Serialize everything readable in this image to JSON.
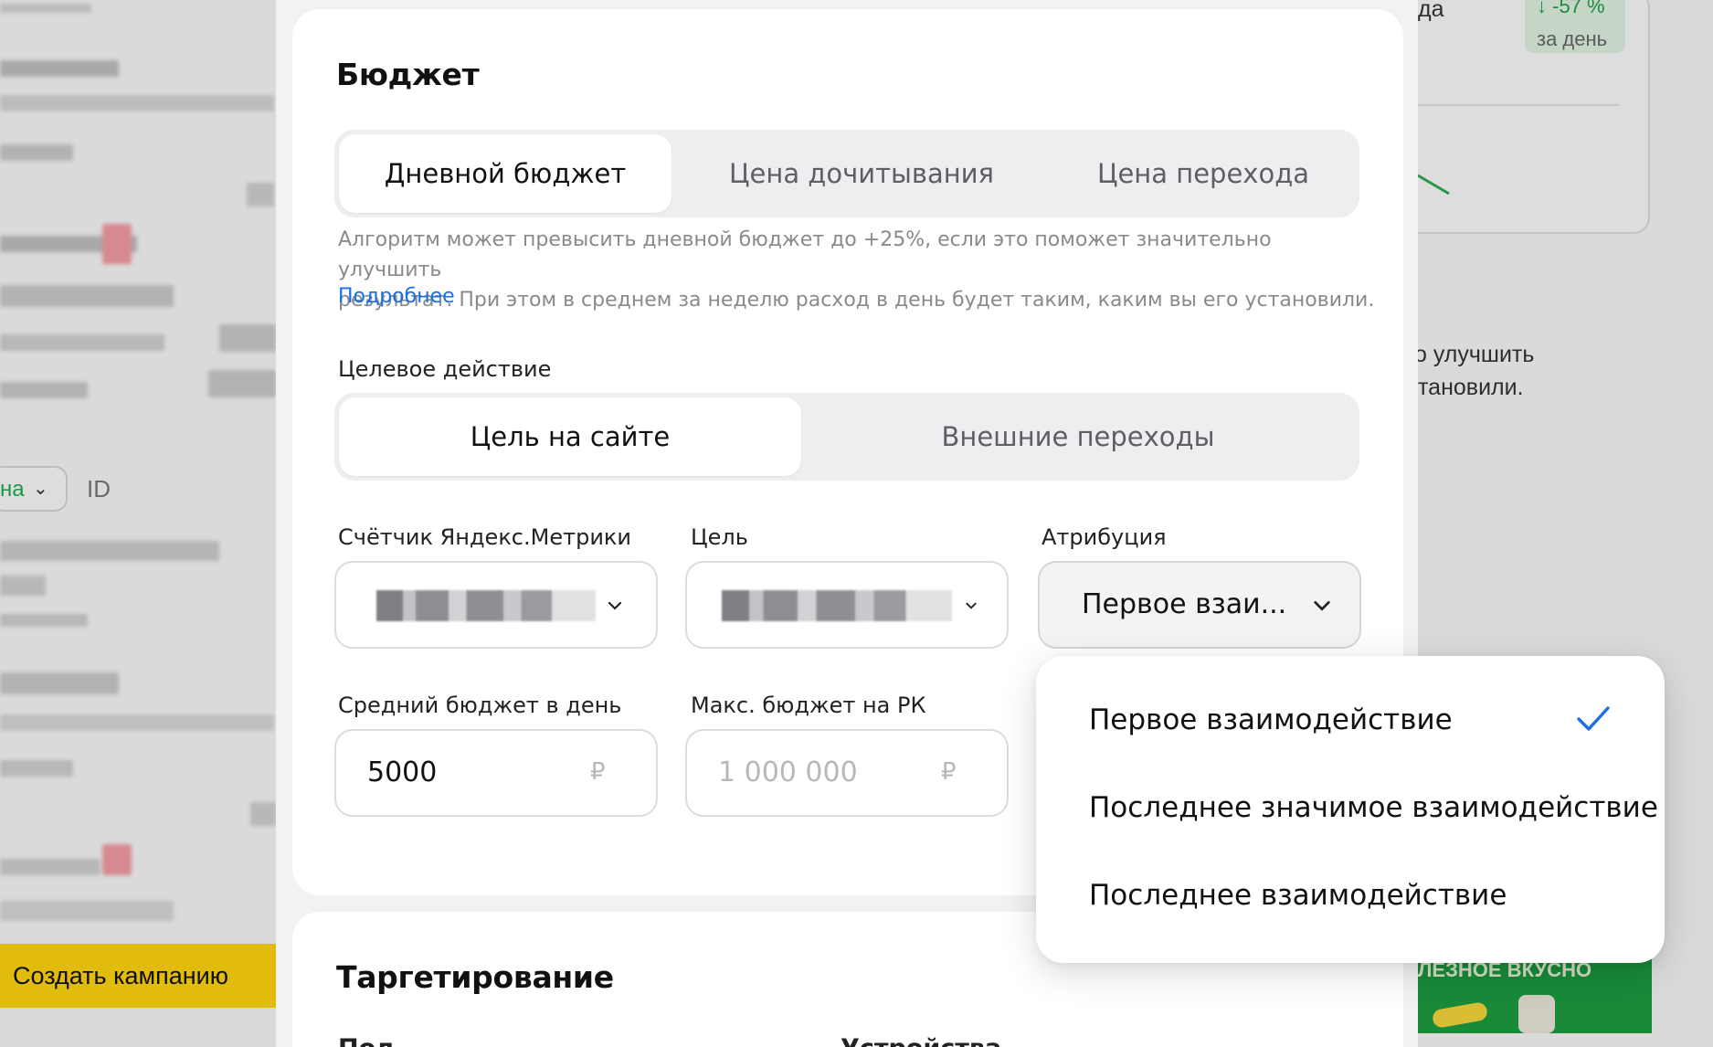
{
  "background": {
    "left": {
      "filter_partial": "на",
      "id_label": "ID",
      "create_campaign_button": "Создать кампанию"
    },
    "right": {
      "stat_partial": "да",
      "stat_change": "-57 %",
      "stat_period": "за день",
      "text_line_1": "о улучшить",
      "text_line_2": "тановили.",
      "promo_text": "ЛЕЗНОЕ ВКУСНО"
    }
  },
  "budget": {
    "title": "Бюджет",
    "strategy_tabs": [
      {
        "label": "Дневной бюджет",
        "active": true
      },
      {
        "label": "Цена дочитывания",
        "active": false
      },
      {
        "label": "Цена перехода",
        "active": false
      }
    ],
    "help_line_1": "Алгоритм может превысить дневной бюджет до +25%, если это поможет значительно улучшить",
    "help_line_2": "результат. При этом в среднем за неделю расход в день будет таким, каким вы его установили.",
    "help_link": "Подробнее",
    "target_action_label": "Целевое действие",
    "target_action_tabs": [
      {
        "label": "Цель на сайте",
        "active": true
      },
      {
        "label": "Внешние переходы",
        "active": false
      }
    ],
    "counter_label": "Счётчик Яндекс.Метрики",
    "goal_label": "Цель",
    "attribution_label": "Атрибуция",
    "attribution_value": "Первое взаи...",
    "avg_daily_label": "Средний бюджет в день",
    "avg_daily_value": "5000",
    "max_budget_label": "Макс. бюджет на РК",
    "max_budget_placeholder": "1 000 000",
    "currency": "₽"
  },
  "attribution_dropdown": {
    "options": [
      {
        "label": "Первое взаимодействие",
        "selected": true
      },
      {
        "label": "Последнее значимое взаимодействие",
        "selected": false
      },
      {
        "label": "Последнее взаимодействие",
        "selected": false
      }
    ]
  },
  "targeting": {
    "title": "Таргетирование",
    "col_1_partial": "Пол",
    "col_2_partial": "Устройства"
  },
  "colors": {
    "accent_link": "#1a6fe6",
    "create_button": "#fcd20e",
    "positive_green": "#1fa84b"
  }
}
